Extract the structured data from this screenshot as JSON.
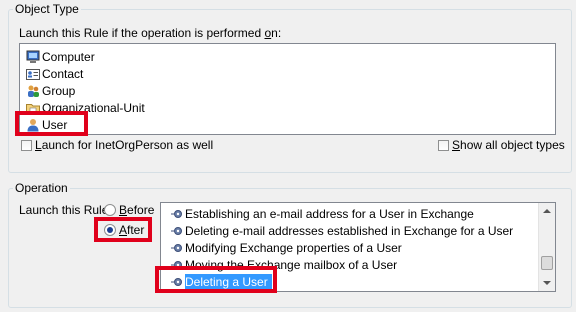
{
  "object_type": {
    "legend": "Object Type",
    "prompt_pre": "Launch this Rule if the operation is performed ",
    "prompt_ul": "o",
    "prompt_post": "n:",
    "items": [
      {
        "label": "Computer",
        "icon": "computer-icon"
      },
      {
        "label": "Contact",
        "icon": "contact-card-icon"
      },
      {
        "label": "Group",
        "icon": "group-icon"
      },
      {
        "label": "Organizational-Unit",
        "icon": "folder-icon"
      },
      {
        "label": "User",
        "icon": "user-icon"
      }
    ],
    "inetorg_ul": "L",
    "inetorg_rest": "aunch for InetOrgPerson as well",
    "inetorg_checked": false,
    "show_all_ul": "S",
    "show_all_rest": "how all object types",
    "show_all_checked": false
  },
  "operation": {
    "legend": "Operation",
    "launch_label": "Launch this Rule",
    "before_ul": "B",
    "before_rest": "efore",
    "after_ul": "A",
    "after_rest": "fter",
    "selected_timing": "After",
    "items": [
      {
        "label": "Establishing an e-mail address for a User in Exchange"
      },
      {
        "label": "Deleting e-mail addresses established in Exchange for a User"
      },
      {
        "label": "Modifying Exchange properties of a User"
      },
      {
        "label": "Moving the Exchange mailbox of a User"
      },
      {
        "label": "Deleting a User",
        "selected": true
      }
    ]
  },
  "colors": {
    "highlight": "#e0001b",
    "selection": "#3399ff"
  }
}
